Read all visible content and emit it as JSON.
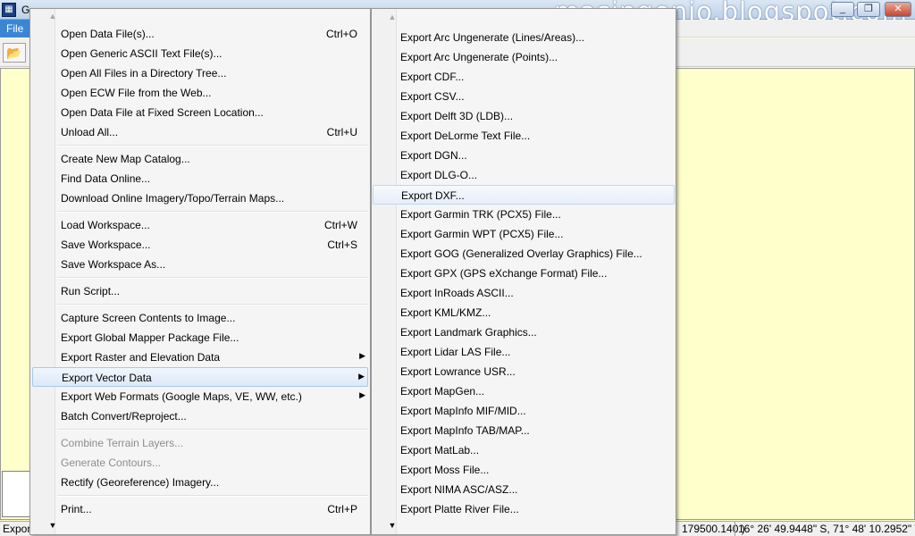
{
  "app": {
    "title_fragment": "G",
    "icon_glyph": "▦",
    "watermark": "masingenio.blogspot.com",
    "window_buttons": [
      "_",
      "❐",
      "✕"
    ]
  },
  "menubar": {
    "file_label": "File"
  },
  "toolbar": {
    "open_glyph": "📂"
  },
  "statusbar": {
    "left_text": "Expor",
    "coords_fragment": "179500.140 )",
    "latlon": "16° 26' 49.9448\" S, 71° 48' 10.2952\" W"
  },
  "file_menu": {
    "top_arrow": "▲",
    "bottom_arrow": "▼",
    "groups": [
      [
        {
          "label": "Open Data File(s)...",
          "shortcut": "Ctrl+O"
        },
        {
          "label": "Open Generic ASCII Text File(s)...",
          "shortcut": ""
        },
        {
          "label": "Open All Files in a Directory Tree...",
          "shortcut": ""
        },
        {
          "label": "Open ECW File from the Web...",
          "shortcut": ""
        },
        {
          "label": "Open Data File at Fixed Screen Location...",
          "shortcut": ""
        },
        {
          "label": "Unload All...",
          "shortcut": "Ctrl+U"
        }
      ],
      [
        {
          "label": "Create New Map Catalog...",
          "shortcut": ""
        },
        {
          "label": "Find Data Online...",
          "shortcut": ""
        },
        {
          "label": "Download Online Imagery/Topo/Terrain Maps...",
          "shortcut": ""
        }
      ],
      [
        {
          "label": "Load Workspace...",
          "shortcut": "Ctrl+W"
        },
        {
          "label": "Save Workspace...",
          "shortcut": "Ctrl+S"
        },
        {
          "label": "Save Workspace As...",
          "shortcut": ""
        }
      ],
      [
        {
          "label": "Run Script...",
          "shortcut": ""
        }
      ],
      [
        {
          "label": "Capture Screen Contents to Image...",
          "shortcut": ""
        },
        {
          "label": "Export Global Mapper Package File...",
          "shortcut": ""
        },
        {
          "label": "Export Raster and Elevation Data",
          "shortcut": "",
          "submenu": true
        },
        {
          "label": "Export Vector Data",
          "shortcut": "",
          "submenu": true,
          "highlighted": true
        },
        {
          "label": "Export Web Formats (Google Maps, VE, WW, etc.)",
          "shortcut": "",
          "submenu": true
        },
        {
          "label": "Batch Convert/Reproject...",
          "shortcut": ""
        }
      ],
      [
        {
          "label": "Combine Terrain Layers...",
          "shortcut": "",
          "disabled": true
        },
        {
          "label": "Generate Contours...",
          "shortcut": "",
          "disabled": true
        },
        {
          "label": "Rectify (Georeference) Imagery...",
          "shortcut": ""
        }
      ],
      [
        {
          "label": "Print...",
          "shortcut": "Ctrl+P"
        }
      ]
    ]
  },
  "export_vector_menu": {
    "top_arrow": "▲",
    "bottom_arrow": "▼",
    "submenu_arrow": "▶",
    "items": [
      {
        "label": "Export Arc Ungenerate (Lines/Areas)..."
      },
      {
        "label": "Export Arc Ungenerate (Points)..."
      },
      {
        "label": "Export CDF..."
      },
      {
        "label": "Export CSV..."
      },
      {
        "label": "Export Delft 3D (LDB)..."
      },
      {
        "label": "Export DeLorme Text File..."
      },
      {
        "label": "Export DGN..."
      },
      {
        "label": "Export DLG-O..."
      },
      {
        "label": "Export DXF...",
        "highlighted": true
      },
      {
        "label": "Export Garmin TRK (PCX5) File..."
      },
      {
        "label": "Export Garmin WPT (PCX5) File..."
      },
      {
        "label": "Export GOG (Generalized Overlay Graphics) File..."
      },
      {
        "label": "Export GPX (GPS eXchange Format) File..."
      },
      {
        "label": "Export InRoads ASCII..."
      },
      {
        "label": "Export KML/KMZ..."
      },
      {
        "label": "Export Landmark Graphics..."
      },
      {
        "label": "Export Lidar LAS File..."
      },
      {
        "label": "Export Lowrance USR..."
      },
      {
        "label": "Export MapGen..."
      },
      {
        "label": "Export MapInfo MIF/MID..."
      },
      {
        "label": "Export MapInfo TAB/MAP..."
      },
      {
        "label": "Export MatLab..."
      },
      {
        "label": "Export Moss File..."
      },
      {
        "label": "Export NIMA ASC/ASZ..."
      },
      {
        "label": "Export Platte River File..."
      }
    ]
  }
}
